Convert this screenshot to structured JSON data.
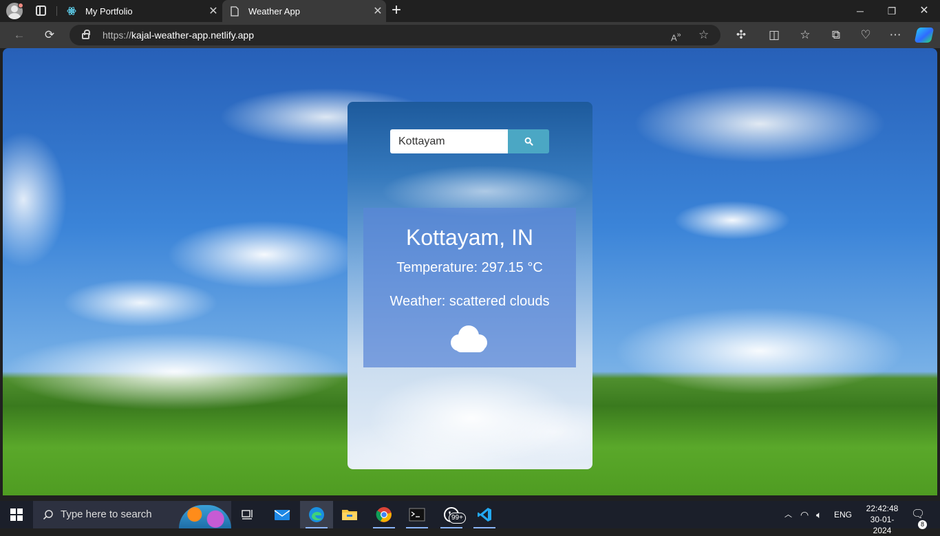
{
  "browser": {
    "tabs": [
      {
        "title": "My Portfolio",
        "icon": "react-atom-icon"
      },
      {
        "title": "Weather App",
        "icon": "page-icon"
      }
    ],
    "url_prefix": "https://",
    "url_host": "kajal-weather-app.netlify.app"
  },
  "weather": {
    "search_value": "Kottayam",
    "city": "Kottayam, IN",
    "temperature": "Temperature: 297.15 °C",
    "description": "Weather: scattered clouds",
    "icon": "cloud-icon"
  },
  "taskbar": {
    "search_placeholder": "Type here to search",
    "whatsapp_badge": "99+",
    "language": "ENG",
    "time": "22:42:48",
    "date": "30-01-2024",
    "notifications": "8"
  }
}
